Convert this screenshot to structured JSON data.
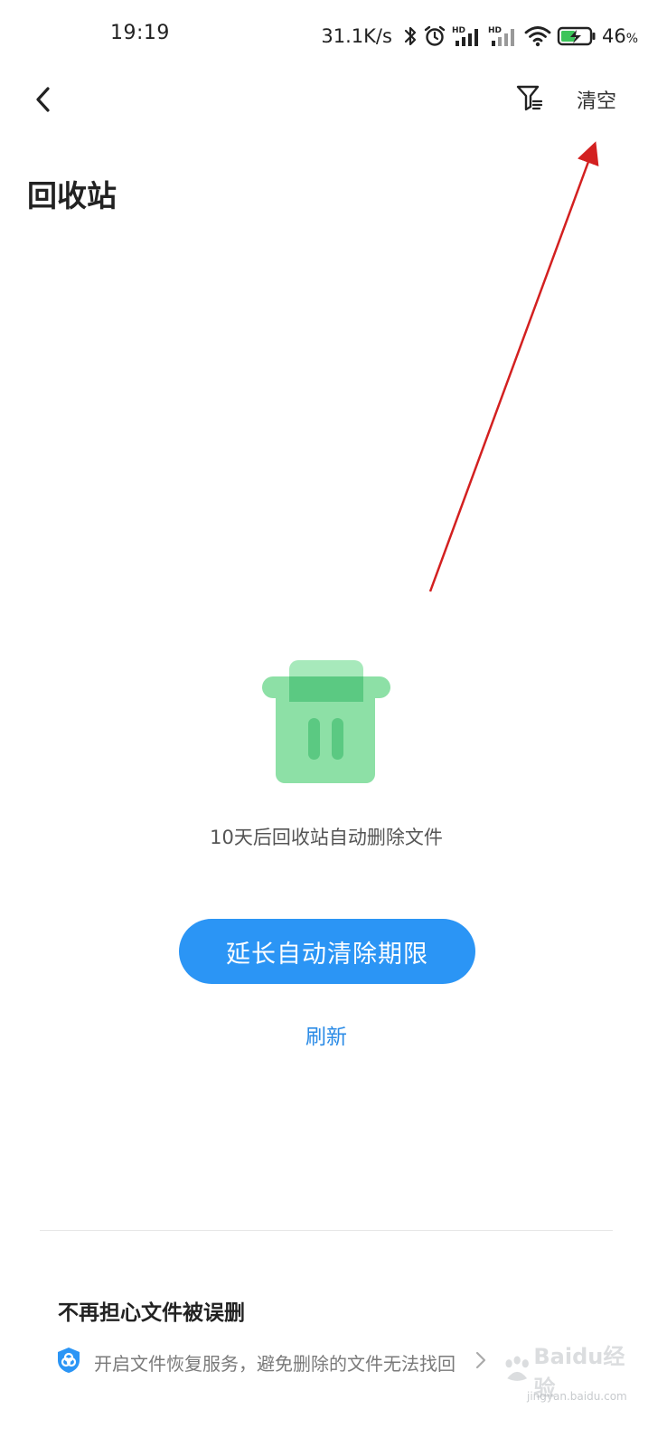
{
  "status_bar": {
    "time": "19:19",
    "network_speed": "31.1K/s",
    "battery": "46",
    "battery_unit": "%",
    "icons": [
      "bluetooth-icon",
      "alarm-icon",
      "hd-signal-icon",
      "hd-signal-icon",
      "wifi-icon",
      "battery-charging-icon"
    ]
  },
  "nav": {
    "back_icon": "chevron-left-icon",
    "filter_icon": "filter-icon",
    "clear_label": "清空"
  },
  "page": {
    "title": "回收站"
  },
  "empty_state": {
    "icon": "trash-bin-icon",
    "message": "10天后回收站自动删除文件",
    "extend_button_label": "延长自动清除期限",
    "refresh_label": "刷新"
  },
  "promo": {
    "title": "不再担心文件被误删",
    "icon": "shield-icon",
    "description": "开启文件恢复服务，避免删除的文件无法找回",
    "chevron_icon": "chevron-right-icon"
  },
  "watermark": {
    "text": "Baidu经验",
    "sub": "jingyan.baidu.com"
  },
  "colors": {
    "accent_blue": "#2b95f5",
    "link_blue": "#2b8be6",
    "trash_green": "#8de0a6",
    "trash_green_dark": "#5bc982",
    "annotation_red": "#d32020"
  }
}
